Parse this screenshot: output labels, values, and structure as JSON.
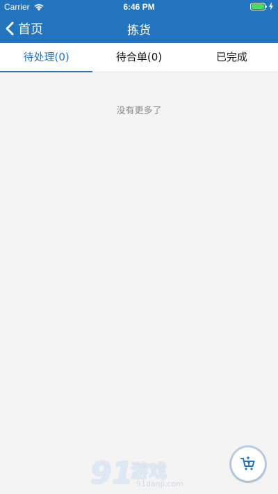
{
  "status_bar": {
    "carrier": "Carrier",
    "time": "6:46 PM",
    "battery_color": "#4cd964"
  },
  "nav": {
    "back_label": "首页",
    "title": "拣货",
    "bar_color": "#2174bd"
  },
  "tabs": [
    {
      "label": "待处理(0)",
      "active": true
    },
    {
      "label": "待合单(0)",
      "active": false
    },
    {
      "label": "已完成",
      "active": false
    }
  ],
  "content": {
    "empty_message": "没有更多了"
  },
  "fab": {
    "icon": "cart-icon"
  },
  "watermark": {
    "number": "91",
    "name": "游戏",
    "url": "91danji.com"
  }
}
